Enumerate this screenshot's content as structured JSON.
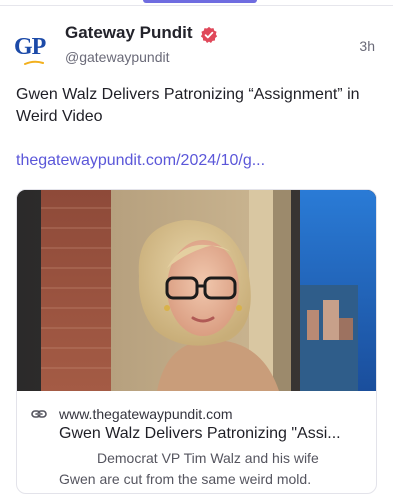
{
  "post": {
    "author_name": "Gateway Pundit",
    "handle": "@gatewaypundit",
    "timestamp": "3h",
    "avatar_initials": "GP",
    "text": "Gwen Walz Delivers Patronizing “Assignment” in Weird Video",
    "link_text": "thegatewaypundit.com/2024/10/g..."
  },
  "card": {
    "domain": "www.thegatewaypundit.com",
    "title": "Gwen Walz Delivers Patronizing \"Assi...",
    "description_line1": "Democrat VP Tim Walz and his wife",
    "description_line2": "Gwen are cut from the same weird mold."
  },
  "colors": {
    "accent": "#6f6ce0",
    "link": "#5b57d9",
    "verified_badge": "#e0485a",
    "avatar_brand": "#1c4aa8"
  },
  "icons": {
    "verified": "verified-badge-icon",
    "link": "link-icon"
  }
}
